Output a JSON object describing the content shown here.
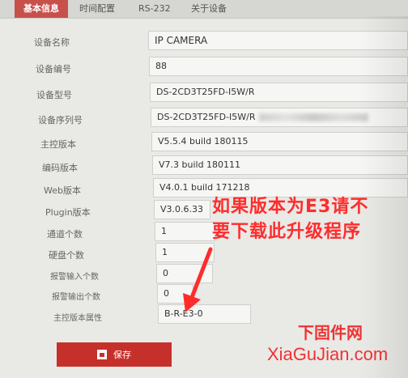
{
  "tabs": [
    "基本信息",
    "时间配置",
    "RS-232",
    "关于设备"
  ],
  "rows": [
    {
      "label": "设备名称",
      "value": "IP CAMERA"
    },
    {
      "label": "设备编号",
      "value": "88"
    },
    {
      "label": "设备型号",
      "value": "DS-2CD3T25FD-I5W/R"
    },
    {
      "label": "设备序列号",
      "value": "DS-2CD3T25FD-I5W/R"
    },
    {
      "label": "主控版本",
      "value": "V5.5.4 build 180115"
    },
    {
      "label": "编码版本",
      "value": "V7.3 build 180111"
    },
    {
      "label": "Web版本",
      "value": "V4.0.1 build 171218"
    },
    {
      "label": "Plugin版本",
      "value": "V3.0.6.33"
    },
    {
      "label": "通道个数",
      "value": "1"
    },
    {
      "label": "硬盘个数",
      "value": "1"
    },
    {
      "label": "报警输入个数",
      "value": "0"
    },
    {
      "label": "报警输出个数",
      "value": "0"
    },
    {
      "label": "主控版本属性",
      "value": "B-R-E3-0"
    }
  ],
  "save_label": "保存",
  "annotation": {
    "line1": "如果版本为E3请不",
    "line2": "要下载此升级程序",
    "color": "#ff2c2c"
  },
  "watermark": {
    "cn": "下固件网",
    "en": "XiaGuJian.com"
  },
  "accent_color": "#c6302a"
}
